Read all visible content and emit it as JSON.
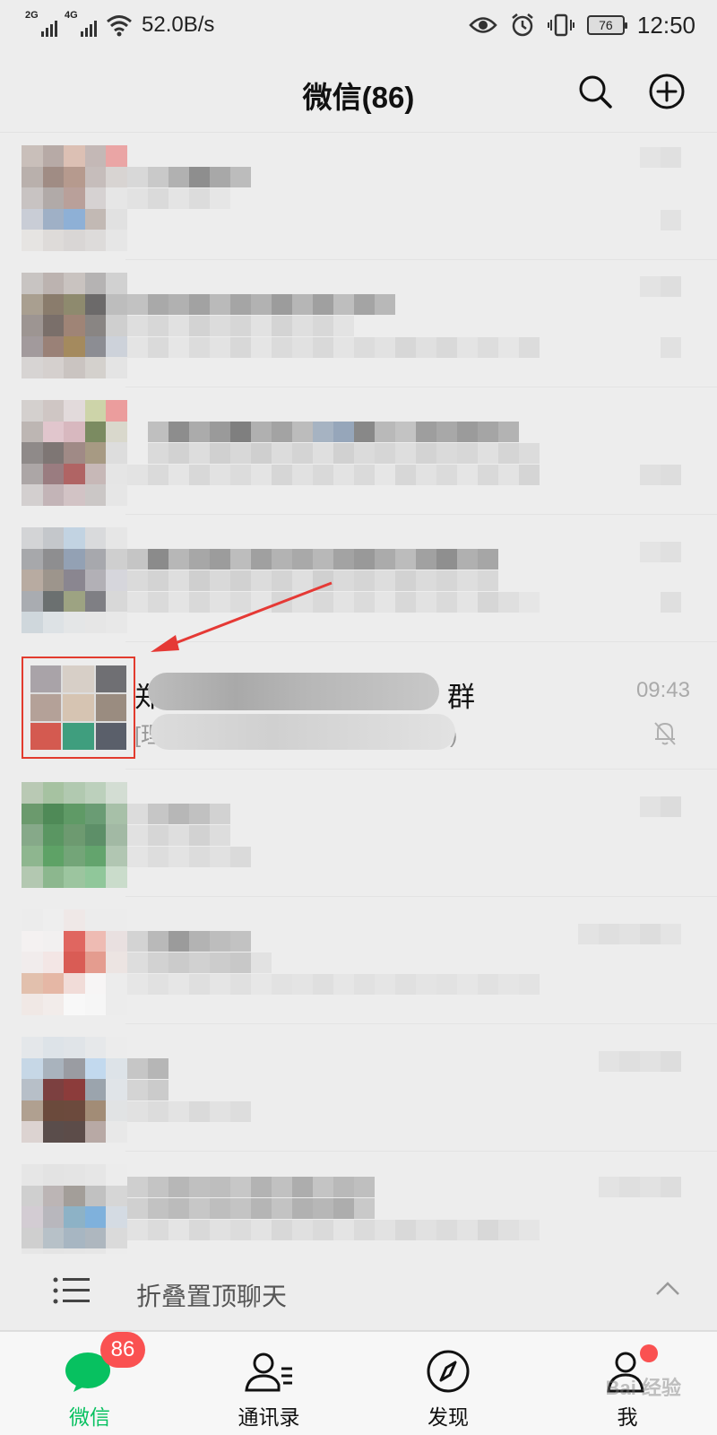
{
  "status_bar": {
    "sim1": "2G",
    "sim2": "4G",
    "net_speed": "52.0B/s",
    "battery": "76",
    "time": "12:50"
  },
  "header": {
    "title": "微信(86)"
  },
  "highlighted_chat": {
    "name_prefix": "郑",
    "name_suffix": "群",
    "preview_prefix": "[理",
    "preview_suffix": ")",
    "time": "09:43",
    "muted": true
  },
  "collapse_bar": {
    "label": "折叠置顶聊天"
  },
  "tabs": [
    {
      "label": "微信",
      "badge": "86",
      "active": true
    },
    {
      "label": "通讯录"
    },
    {
      "label": "发现"
    },
    {
      "label": "我",
      "dot": true
    }
  ],
  "watermark": "Bai 经验",
  "colors": {
    "accent_green": "#07c160",
    "badge_red": "#fa5151",
    "highlight_red": "#e23b2e"
  }
}
